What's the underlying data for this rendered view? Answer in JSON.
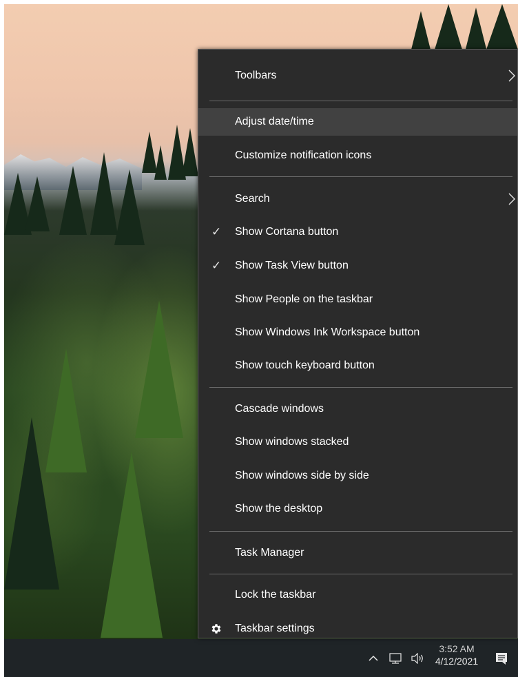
{
  "context_menu": {
    "items": [
      {
        "label": "Toolbars"
      },
      {
        "label": "Adjust date/time"
      },
      {
        "label": "Customize notification icons"
      },
      {
        "label": "Search"
      },
      {
        "label": "Show Cortana button"
      },
      {
        "label": "Show Task View button"
      },
      {
        "label": "Show People on the taskbar"
      },
      {
        "label": "Show Windows Ink Workspace button"
      },
      {
        "label": "Show touch keyboard button"
      },
      {
        "label": "Cascade windows"
      },
      {
        "label": "Show windows stacked"
      },
      {
        "label": "Show windows side by side"
      },
      {
        "label": "Show the desktop"
      },
      {
        "label": "Task Manager"
      },
      {
        "label": "Lock the taskbar"
      },
      {
        "label": "Taskbar settings"
      }
    ],
    "check_glyph": "✓",
    "checked_items": [
      "Show Cortana button",
      "Show Task View button"
    ],
    "highlighted_item": "Adjust date/time",
    "submenu_items": [
      "Toolbars",
      "Search"
    ],
    "settings_icon": "gear-icon"
  },
  "taskbar": {
    "tray_icons": [
      "chevron-up-icon",
      "network-icon",
      "volume-icon"
    ],
    "clock": {
      "time": "3:52 AM",
      "date": "4/12/2021"
    },
    "notification_icon": "action-center-icon"
  },
  "colors": {
    "menu_bg": "#2b2b2b",
    "menu_hover": "#414141",
    "taskbar_bg": "#1f2427",
    "text": "#ffffff"
  }
}
